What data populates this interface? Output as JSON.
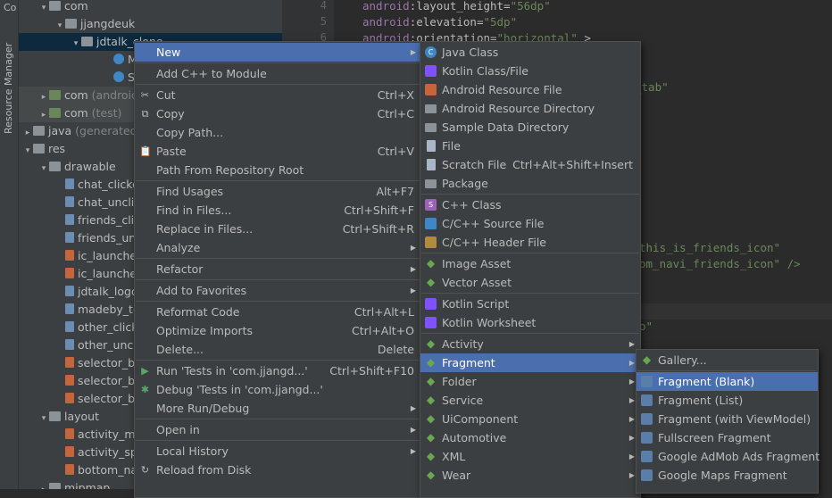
{
  "side_strip": {
    "top_label": "Co",
    "resource_manager": "Resource Manager"
  },
  "tree": [
    {
      "text": "com",
      "indent": 1,
      "arrow": "▾",
      "icon": "folder"
    },
    {
      "text": "jjangdeuk",
      "indent": 2,
      "arrow": "▾",
      "icon": "folder"
    },
    {
      "text": "jdtalk_clone",
      "indent": 3,
      "arrow": "▾",
      "icon": "folder",
      "sel": true
    },
    {
      "text": "MainActi",
      "indent": 5,
      "icon": "kt"
    },
    {
      "text": "SplashSc",
      "indent": 5,
      "icon": "kt"
    },
    {
      "text": "com",
      "suffix": "(androidTest)",
      "indent": 1,
      "arrow": "▸",
      "icon": "folder",
      "band": true
    },
    {
      "text": "com",
      "suffix": "(test)",
      "indent": 1,
      "arrow": "▸",
      "icon": "folder",
      "band": true
    },
    {
      "text": "java",
      "suffix": "(generated)",
      "indent": 0,
      "arrow": "▸",
      "icon": "folder"
    },
    {
      "text": "res",
      "indent": 0,
      "arrow": "▾",
      "icon": "folder"
    },
    {
      "text": "drawable",
      "indent": 1,
      "arrow": "▾",
      "icon": "folder"
    },
    {
      "text": "chat_clicked.png",
      "indent": 2,
      "icon": "img"
    },
    {
      "text": "chat_unclick.png",
      "indent": 2,
      "icon": "img"
    },
    {
      "text": "friends_clicked.p",
      "indent": 2,
      "icon": "img"
    },
    {
      "text": "friends_unclick.p",
      "indent": 2,
      "icon": "img"
    },
    {
      "text": "ic_launcher_bac",
      "indent": 2,
      "icon": "xml"
    },
    {
      "text": "ic_launcher_fore",
      "indent": 2,
      "icon": "xml"
    },
    {
      "text": "jdtalk_logo.png",
      "indent": 2,
      "icon": "img"
    },
    {
      "text": "madeby_text.pn",
      "indent": 2,
      "icon": "img"
    },
    {
      "text": "other_clicked.pr",
      "indent": 2,
      "icon": "img"
    },
    {
      "text": "other_unclick.pr",
      "indent": 2,
      "icon": "img"
    },
    {
      "text": "selector_bottom",
      "indent": 2,
      "icon": "xml"
    },
    {
      "text": "selector_bottom",
      "indent": 2,
      "icon": "xml"
    },
    {
      "text": "selector_bottom",
      "indent": 2,
      "icon": "xml"
    },
    {
      "text": "layout",
      "indent": 1,
      "arrow": "▾",
      "icon": "folder"
    },
    {
      "text": "activity_main.xn",
      "indent": 2,
      "icon": "xml"
    },
    {
      "text": "activity_splash_s",
      "indent": 2,
      "icon": "xml"
    },
    {
      "text": "bottom_navigat",
      "indent": 2,
      "icon": "xml"
    },
    {
      "text": "mipmap",
      "indent": 1,
      "arrow": "▸",
      "icon": "folder"
    }
  ],
  "gutter": [
    "4",
    "5",
    "6"
  ],
  "code": [
    {
      "parts": [
        [
          "a",
          "android"
        ],
        [
          "k",
          ":layout_height="
        ],
        [
          "s",
          "\"56dp\""
        ]
      ]
    },
    {
      "parts": [
        [
          "a",
          "android"
        ],
        [
          "k",
          ":elevation="
        ],
        [
          "s",
          "\"5dp\""
        ]
      ]
    },
    {
      "parts": [
        [
          "a",
          "android"
        ],
        [
          "k",
          ":orientation="
        ],
        [
          "s",
          "\"horizontal\""
        ],
        [
          "k",
          " >"
        ]
      ]
    }
  ],
  "code_fragments": {
    "tab": "_tab\"",
    "friends_icon": "this_is_friends_icon\"",
    "navi_icon": "om_navi_friends_icon\" />",
    "o": "o\""
  },
  "context_menu": {
    "items": [
      {
        "label": "New",
        "sub": true,
        "hl": true
      },
      {
        "sep": true
      },
      {
        "label": "Add C++ to Module"
      },
      {
        "sep": true
      },
      {
        "label": "Cut",
        "sc": "Ctrl+X",
        "icon": "✂",
        "u": "t"
      },
      {
        "label": "Copy",
        "sc": "Ctrl+C",
        "icon": "⧉",
        "u": "C"
      },
      {
        "label": "Copy Path..."
      },
      {
        "label": "Paste",
        "sc": "Ctrl+V",
        "icon": "📋",
        "u": "P"
      },
      {
        "label": "Path From Repository Root"
      },
      {
        "sep": true
      },
      {
        "label": "Find Usages",
        "sc": "Alt+F7",
        "u": "U"
      },
      {
        "label": "Find in Files...",
        "sc": "Ctrl+Shift+F"
      },
      {
        "label": "Replace in Files...",
        "sc": "Ctrl+Shift+R"
      },
      {
        "label": "Analyze",
        "sub": true
      },
      {
        "sep": true
      },
      {
        "label": "Refactor",
        "sub": true
      },
      {
        "sep": true
      },
      {
        "label": "Add to Favorites",
        "sub": true
      },
      {
        "sep": true
      },
      {
        "label": "Reformat Code",
        "sc": "Ctrl+Alt+L"
      },
      {
        "label": "Optimize Imports",
        "sc": "Ctrl+Alt+O"
      },
      {
        "label": "Delete...",
        "sc": "Delete"
      },
      {
        "sep": true
      },
      {
        "label": "Run 'Tests in 'com.jjangd...'",
        "sc": "Ctrl+Shift+F10",
        "icon": "▶",
        "iclass": "i-run"
      },
      {
        "label": "Debug 'Tests in 'com.jjangd...'",
        "icon": "✱",
        "iclass": "i-bug"
      },
      {
        "label": "More Run/Debug",
        "sub": true
      },
      {
        "sep": true
      },
      {
        "label": "Open in",
        "sub": true
      },
      {
        "sep": true
      },
      {
        "label": "Local History",
        "sub": true
      },
      {
        "label": "Reload from Disk",
        "icon": "↻"
      }
    ]
  },
  "new_menu": {
    "items": [
      {
        "label": "Java Class",
        "iclass": "i-java",
        "icon": "C"
      },
      {
        "label": "Kotlin Class/File",
        "iclass": "i-kt"
      },
      {
        "label": "Android Resource File",
        "iclass": "i-res"
      },
      {
        "label": "Android Resource Directory",
        "iclass": "i-fold"
      },
      {
        "label": "Sample Data Directory",
        "iclass": "i-fold"
      },
      {
        "label": "File",
        "iclass": "i-file"
      },
      {
        "label": "Scratch File",
        "sc": "Ctrl+Alt+Shift+Insert",
        "iclass": "i-file"
      },
      {
        "label": "Package",
        "iclass": "i-fold"
      },
      {
        "sep": true
      },
      {
        "label": "C++ Class",
        "iclass": "i-cpp",
        "icon": "S"
      },
      {
        "label": "C/C++ Source File",
        "iclass": "i-cs"
      },
      {
        "label": "C/C++ Header File",
        "iclass": "i-ch"
      },
      {
        "sep": true
      },
      {
        "label": "Image Asset",
        "iclass": "i-andr",
        "icon": "◆"
      },
      {
        "label": "Vector Asset",
        "iclass": "i-andr",
        "icon": "◆"
      },
      {
        "sep": true
      },
      {
        "label": "Kotlin Script",
        "iclass": "i-kt"
      },
      {
        "label": "Kotlin Worksheet",
        "iclass": "i-kt"
      },
      {
        "sep": true
      },
      {
        "label": "Activity",
        "iclass": "i-andr",
        "icon": "◆",
        "sub": true
      },
      {
        "label": "Fragment",
        "iclass": "i-andr",
        "icon": "◆",
        "sub": true,
        "hl": true
      },
      {
        "label": "Folder",
        "iclass": "i-andr",
        "icon": "◆",
        "sub": true
      },
      {
        "label": "Service",
        "iclass": "i-andr",
        "icon": "◆",
        "sub": true
      },
      {
        "label": "UiComponent",
        "iclass": "i-andr",
        "icon": "◆",
        "sub": true
      },
      {
        "label": "Automotive",
        "iclass": "i-andr",
        "icon": "◆",
        "sub": true
      },
      {
        "label": "XML",
        "iclass": "i-andr",
        "icon": "◆",
        "sub": true
      },
      {
        "label": "Wear",
        "iclass": "i-andr",
        "icon": "◆",
        "sub": true
      }
    ]
  },
  "fragment_menu": {
    "items": [
      {
        "label": "Gallery...",
        "iclass": "i-andr",
        "icon": "◆"
      },
      {
        "sep": true
      },
      {
        "label": "Fragment (Blank)",
        "iclass": "i-frag",
        "hl": true
      },
      {
        "label": "Fragment (List)",
        "iclass": "i-frag"
      },
      {
        "label": "Fragment (with ViewModel)",
        "iclass": "i-frag"
      },
      {
        "label": "Fullscreen Fragment",
        "iclass": "i-frag"
      },
      {
        "label": "Google AdMob Ads Fragment",
        "iclass": "i-frag"
      },
      {
        "label": "Google Maps Fragment",
        "iclass": "i-frag"
      }
    ]
  }
}
